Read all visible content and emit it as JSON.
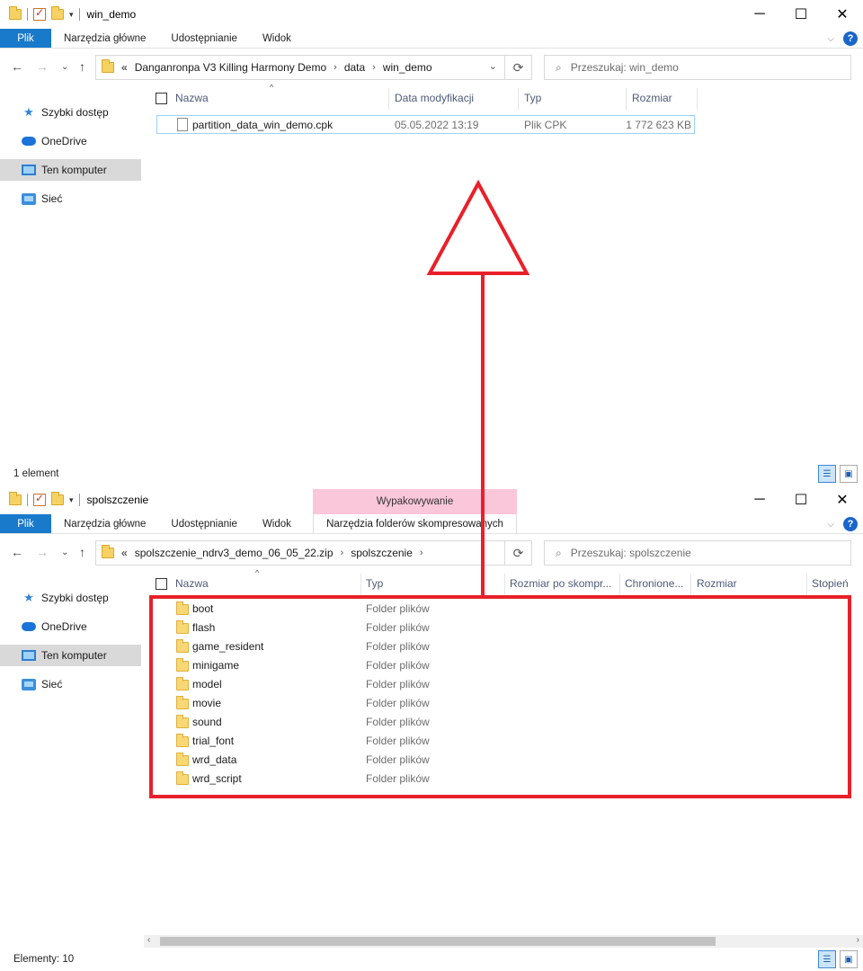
{
  "top": {
    "title": "win_demo",
    "ribbon_tabs": [
      "Plik",
      "Narzędzia główne",
      "Udostępnianie",
      "Widok"
    ],
    "breadcrumb": [
      "«",
      "Danganronpa V3 Killing Harmony Demo",
      "data",
      "win_demo"
    ],
    "search_placeholder": "Przeszukaj: win_demo",
    "nav": [
      "Szybki dostęp",
      "OneDrive",
      "Ten komputer",
      "Sieć"
    ],
    "columns": [
      "Nazwa",
      "Data modyfikacji",
      "Typ",
      "Rozmiar"
    ],
    "files": [
      {
        "name": "partition_data_win_demo.cpk",
        "date": "05.05.2022 13:19",
        "type": "Plik CPK",
        "size": "1 772 623 KB"
      }
    ],
    "status": "1 element"
  },
  "bottom": {
    "title": "spolszczenie",
    "context_header": "Wypakowywanie",
    "context_tab": "Narzędzia folderów skompresowanych",
    "ribbon_tabs": [
      "Plik",
      "Narzędzia główne",
      "Udostępnianie",
      "Widok"
    ],
    "breadcrumb": [
      "«",
      "spolszczenie_ndrv3_demo_06_05_22.zip",
      "spolszczenie"
    ],
    "search_placeholder": "Przeszukaj: spolszczenie",
    "nav": [
      "Szybki dostęp",
      "OneDrive",
      "Ten komputer",
      "Sieć"
    ],
    "columns": [
      "Nazwa",
      "Typ",
      "Rozmiar po skompr...",
      "Chronione...",
      "Rozmiar",
      "Stopień"
    ],
    "folders": [
      {
        "name": "boot",
        "type": "Folder plików"
      },
      {
        "name": "flash",
        "type": "Folder plików"
      },
      {
        "name": "game_resident",
        "type": "Folder plików"
      },
      {
        "name": "minigame",
        "type": "Folder plików"
      },
      {
        "name": "model",
        "type": "Folder plików"
      },
      {
        "name": "movie",
        "type": "Folder plików"
      },
      {
        "name": "sound",
        "type": "Folder plików"
      },
      {
        "name": "trial_font",
        "type": "Folder plików"
      },
      {
        "name": "wrd_data",
        "type": "Folder plików"
      },
      {
        "name": "wrd_script",
        "type": "Folder plików"
      }
    ],
    "status": "Elementy: 10"
  },
  "colors": {
    "annotation": "#e8202a",
    "plik_tab": "#1979ca",
    "context_pink": "#f9c6da"
  },
  "icons": [
    "folder-icon",
    "file-icon",
    "star-icon",
    "cloud-icon",
    "computer-icon",
    "network-icon",
    "help-icon",
    "refresh-icon",
    "search-icon"
  ]
}
